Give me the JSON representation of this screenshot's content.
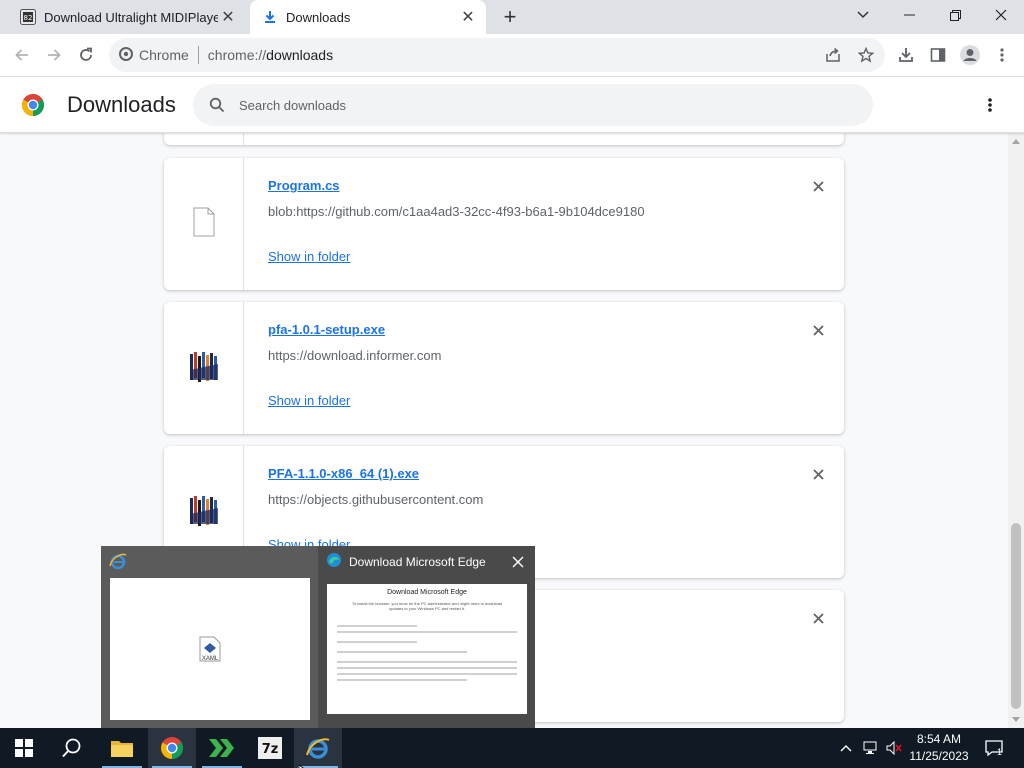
{
  "browser": {
    "tabs": [
      {
        "title": "Download Ultralight MIDIPlayer",
        "active": false
      },
      {
        "title": "Downloads",
        "active": true
      }
    ],
    "new_tab_symbol": "+",
    "omnibox": {
      "chip_label": "Chrome",
      "url_scheme": "chrome://",
      "url_host": "downloads"
    }
  },
  "page": {
    "title": "Downloads",
    "search_placeholder": "Search downloads"
  },
  "downloads": [
    {
      "filename": "Program.cs",
      "source": "blob:https://github.com/c1aa4ad3-32cc-4f93-b6a1-9b104dce9180",
      "action": "Show in folder",
      "icon": "generic-file-icon"
    },
    {
      "filename": "pfa-1.0.1-setup.exe",
      "source": "https://download.informer.com",
      "action": "Show in folder",
      "icon": "pfa-app-icon"
    },
    {
      "filename": "PFA-1.1.0-x86_64 (1).exe",
      "source": "https://objects.githubusercontent.com",
      "action": "Show in folder",
      "icon": "pfa-app-icon"
    }
  ],
  "taskbar_popup": {
    "window1": {
      "icon": "internet-explorer-icon",
      "preview_label": "XAML"
    },
    "window2": {
      "icon": "edge-icon",
      "title": "Download Microsoft Edge",
      "preview_heading": "Download Microsoft Edge",
      "preview_text": "To install the browser, you must be the PC administrator and might need to download updates to your Windows PC and restart it."
    }
  },
  "taskbar": {
    "time": "8:54 AM",
    "date": "11/25/2023",
    "notification_count": "1",
    "pinned": [
      "start",
      "search",
      "file-explorer",
      "chrome",
      "app-green",
      "7zip",
      "internet-explorer"
    ]
  },
  "colors": {
    "accent": "#1a73e8",
    "tabstrip": "#dee1e6",
    "content_bg": "#f8f9fa",
    "taskbar": "#101a24"
  }
}
